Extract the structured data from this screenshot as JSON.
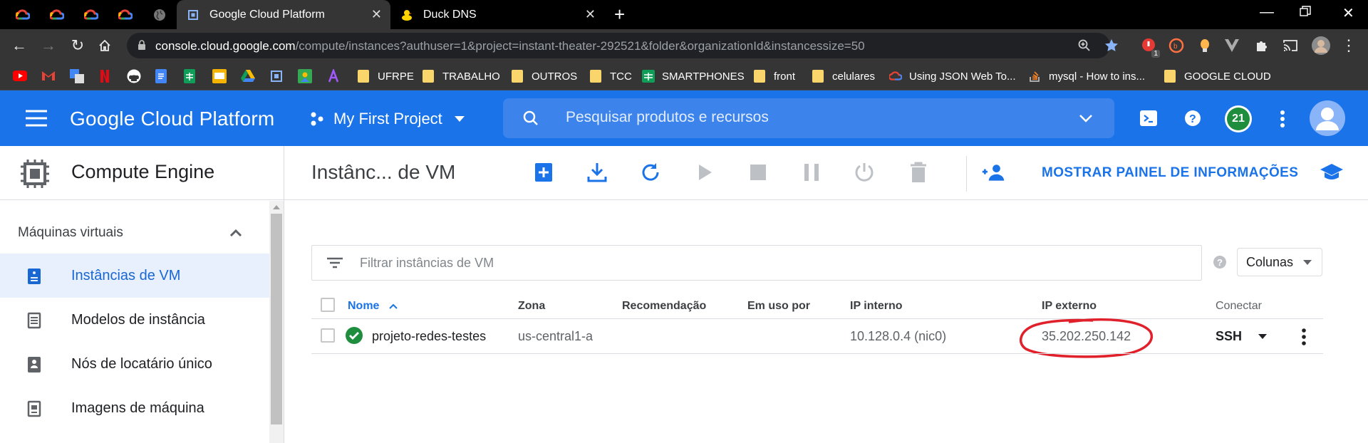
{
  "browser": {
    "tabs": [
      {
        "title": "Google Cloud Platform",
        "active": true
      },
      {
        "title": "Duck DNS",
        "active": false
      }
    ],
    "url_host": "console.cloud.google.com",
    "url_path": "/compute/instances?authuser=1&project=instant-theater-292521&folder&organizationId&instancessize=50",
    "extension_badge": "1"
  },
  "bookmarks": [
    {
      "label": "UFRPE",
      "icon": "folder-icon"
    },
    {
      "label": "TRABALHO",
      "icon": "folder-icon"
    },
    {
      "label": "OUTROS",
      "icon": "folder-icon"
    },
    {
      "label": "TCC",
      "icon": "folder-icon"
    },
    {
      "label": "SMARTPHONES",
      "icon": "sheets-icon"
    },
    {
      "label": "front",
      "icon": "folder-icon"
    },
    {
      "label": "celulares",
      "icon": "folder-icon"
    },
    {
      "label": "Using JSON Web To...",
      "icon": "cloud-icon"
    },
    {
      "label": "mysql - How to ins...",
      "icon": "stackoverflow-icon"
    },
    {
      "label": "GOOGLE CLOUD",
      "icon": "folder-icon"
    }
  ],
  "gcp": {
    "brand": "Google Cloud Platform",
    "project": "My First Project",
    "search_placeholder": "Pesquisar produtos e recursos",
    "notifications": "21"
  },
  "subheader": {
    "product": "Compute Engine",
    "page_title": "Instânc... de VM",
    "show_info": "MOSTRAR PAINEL DE INFORMAÇÕES"
  },
  "sidebar": {
    "section": "Máquinas virtuais",
    "items": [
      {
        "label": "Instâncias de VM",
        "active": true
      },
      {
        "label": "Modelos de instância",
        "active": false
      },
      {
        "label": "Nós de locatário único",
        "active": false
      },
      {
        "label": "Imagens de máquina",
        "active": false
      }
    ]
  },
  "table": {
    "filter_placeholder": "Filtrar instâncias de VM",
    "columns_button": "Colunas",
    "headers": [
      "Nome",
      "Zona",
      "Recomendação",
      "Em uso por",
      "IP interno",
      "IP externo",
      "Conectar"
    ],
    "rows": [
      {
        "name": "projeto-redes-testes",
        "zone": "us-central1-a",
        "recommendation": "",
        "in_use_by": "",
        "internal_ip": "10.128.0.4",
        "internal_nic": "nic0",
        "external_ip": "35.202.250.142",
        "connect": "SSH",
        "status": "running"
      }
    ]
  },
  "colors": {
    "gcp_blue": "#1a73e8",
    "highlight_red": "#e0202a",
    "status_green": "#1e8e3e"
  }
}
